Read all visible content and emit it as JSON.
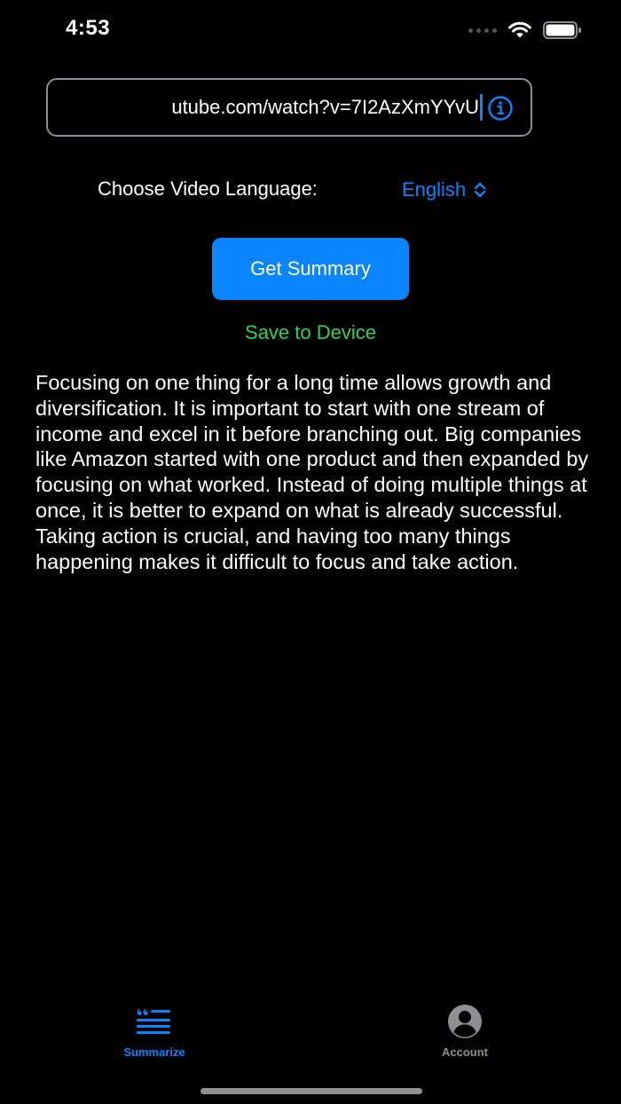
{
  "status_bar": {
    "time": "4:53"
  },
  "url_field": {
    "value": "utube.com/watch?v=7I2AzXmYYvU",
    "info_icon": "info-circle-icon"
  },
  "language": {
    "label": "Choose Video Language:",
    "selected": "English"
  },
  "actions": {
    "get_summary": "Get Summary",
    "save_to_device": "Save to Device"
  },
  "summary": {
    "text": "Focusing on one thing for a long time allows growth and diversification. It is important to start with one stream of income and excel in it before branching out. Big companies like Amazon started with one product and then expanded by focusing on what worked. Instead of doing multiple things at once, it is better to expand on what is already successful. Taking action is crucial, and having too many things happening makes it difficult to focus and take action."
  },
  "tab_bar": {
    "items": [
      {
        "label": "Summarize",
        "icon": "quote-lines-icon",
        "active": true
      },
      {
        "label": "Account",
        "icon": "account-circle-icon",
        "active": false
      }
    ]
  },
  "colors": {
    "background": "#000000",
    "accent": "#0a84ff",
    "save_green": "#30d158",
    "inactive_gray": "#8e8e93"
  }
}
